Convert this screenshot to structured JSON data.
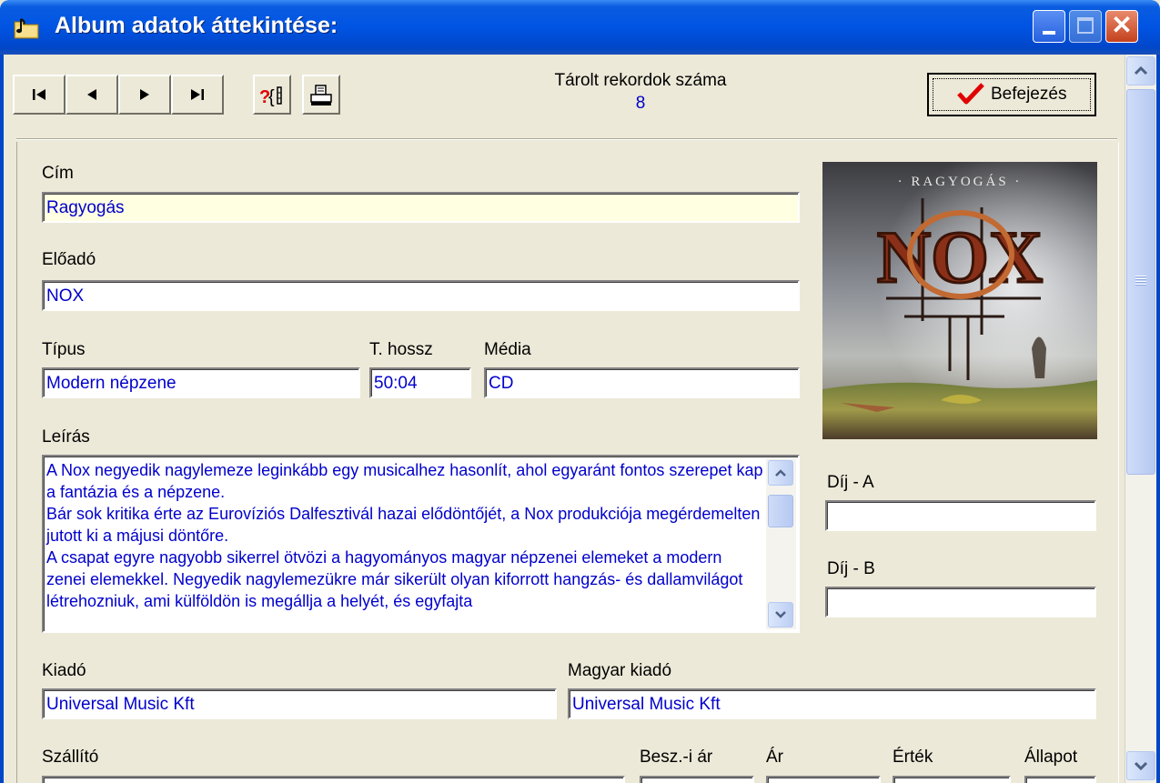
{
  "window": {
    "title": "Album adatok áttekintése:",
    "icon": "folder-note-icon"
  },
  "toolbar": {
    "first_icon": "⏮",
    "prev_icon": "◀",
    "next_icon": "▶",
    "last_icon": "⏭",
    "record_count_label": "Tárolt rekordok száma",
    "record_count": "8",
    "finish_label": "Befejezés"
  },
  "form": {
    "title_label": "Cím",
    "title_value": "Ragyogás",
    "artist_label": "Előadó",
    "artist_value": "NOX",
    "type_label": "Típus",
    "type_value": "Modern népzene",
    "length_label": "T. hossz",
    "length_value": "50:04",
    "media_label": "Média",
    "media_value": "CD",
    "desc_label": "Leírás",
    "desc_value": "A Nox negyedik nagylemeze leginkább egy musicalhez hasonlít, ahol egyaránt fontos szerepet kap a fantázia és a népzene.\nBár sok kritika érte az Eurovíziós Dalfesztivál hazai elődöntőjét, a Nox produkciója megérdemelten jutott ki a májusi döntőre.\nA csapat egyre nagyobb sikerrel ötvözi a hagyományos magyar népzenei elemeket a modern zenei elemekkel. Negyedik nagylemezükre már sikerült olyan kiforrott hangzás- és dallamvilágot létrehozniuk, ami külföldön is megállja a helyét, és egyfajta",
    "award_a_label": "Díj - A",
    "award_a_value": "",
    "award_b_label": "Díj - B",
    "award_b_value": "",
    "publisher_label": "Kiadó",
    "publisher_value": "Universal Music Kft",
    "hu_publisher_label": "Magyar kiadó",
    "hu_publisher_value": "Universal Music Kft",
    "supplier_label": "Szállító",
    "purchase_price_label": "Besz.-i ár",
    "price_label": "Ár",
    "value_label": "Érték",
    "status_label": "Állapot"
  },
  "cover": {
    "banner_text": "· RAGYOGÁS ·",
    "logo_text": "NOX"
  },
  "colors": {
    "titlebar": "#0054e3",
    "field_text": "#0000cc",
    "window_bg": "#ece9d8",
    "required_field_bg": "#ffffe1",
    "finish_check": "#e00000"
  }
}
